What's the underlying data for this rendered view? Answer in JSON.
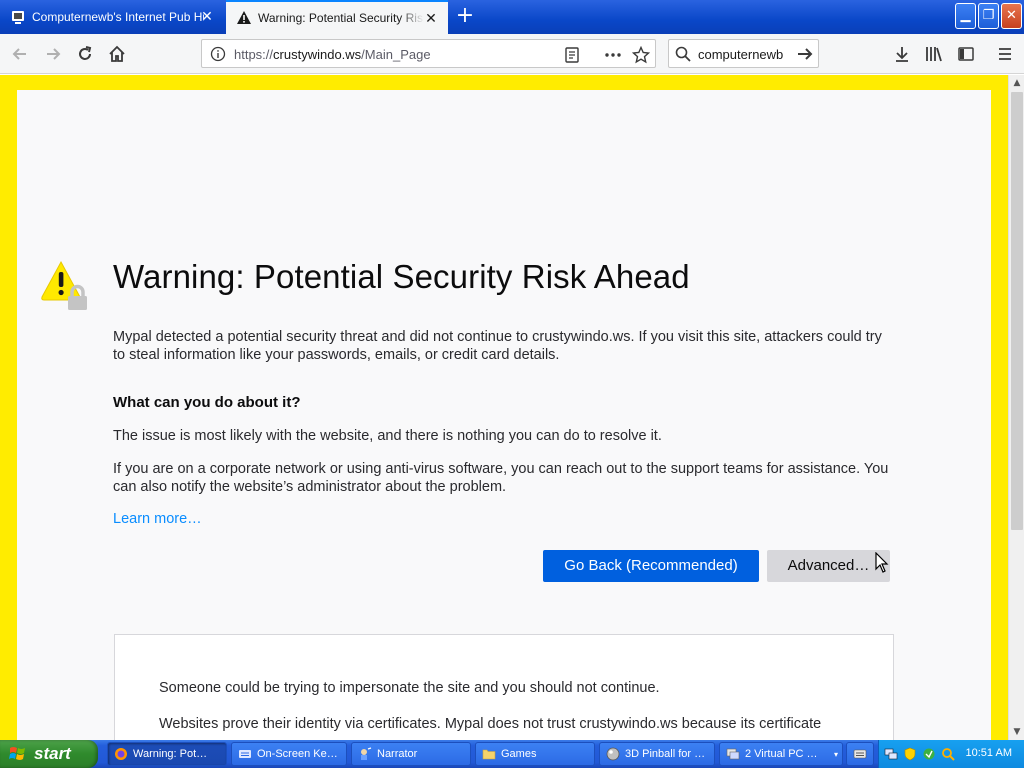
{
  "window": {
    "tabs": [
      {
        "title": "Computernewb's Internet Pub Hub",
        "active": false
      },
      {
        "title": "Warning: Potential Security Risk Ahead",
        "active": true
      }
    ],
    "min_label": "▁",
    "max_label": "❐",
    "close_label": "✕"
  },
  "navbar": {
    "url_prefix": "https://",
    "url_host": "crustywindo.ws",
    "url_path": "/Main_Page",
    "search_value": "computernewb"
  },
  "page": {
    "title": "Warning: Potential Security Risk Ahead",
    "intro": "Mypal detected a potential security threat and did not continue to crustywindo.ws. If you visit this site, attackers could try to steal information like your passwords, emails, or credit card details.",
    "question": "What can you do about it?",
    "answer1": "The issue is most likely with the website, and there is nothing you can do to resolve it.",
    "answer2": "If you are on a corporate network or using anti-virus software, you can reach out to the support teams for assistance. You can also notify the website’s administrator about the problem.",
    "learn_more": "Learn more…",
    "go_back": "Go Back (Recommended)",
    "advanced": "Advanced…",
    "details1": "Someone could be trying to impersonate the site and you should not continue.",
    "details2": "Websites prove their identity via certificates. Mypal does not trust crustywindo.ws because its certificate"
  },
  "colors": {
    "frame": "#ffec00",
    "primary_button": "#0060df",
    "link": "#0a8dff",
    "warning_icon": "#ffe900"
  },
  "taskbar": {
    "start_label": "start",
    "tasks": [
      {
        "label": "Warning: Pot…",
        "icon": "firefox-icon",
        "active": true
      },
      {
        "label": "On-Screen Ke…",
        "icon": "keyboard-icon",
        "active": false
      },
      {
        "label": "Narrator",
        "icon": "narrator-icon",
        "active": false
      },
      {
        "label": "Games",
        "icon": "folder-icon",
        "active": false
      },
      {
        "label": "3D Pinball for …",
        "icon": "pinball-icon",
        "active": false
      },
      {
        "label": "2 Virtual PC …",
        "icon": "virtual-pc-icon",
        "active": false
      }
    ],
    "clock": "10:51 AM"
  }
}
